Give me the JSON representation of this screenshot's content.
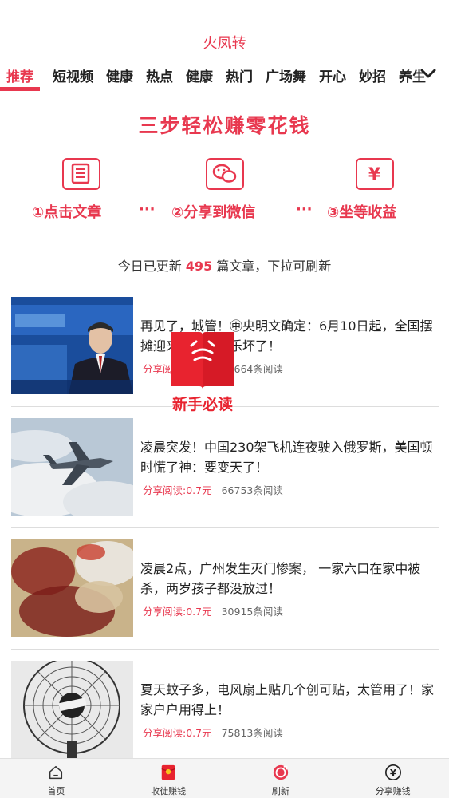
{
  "header": {
    "title": "火凤转"
  },
  "tabs": [
    {
      "label": "推荐",
      "active": true
    },
    {
      "label": "短视频"
    },
    {
      "label": "健康"
    },
    {
      "label": "热点"
    },
    {
      "label": "健康"
    },
    {
      "label": "热门"
    },
    {
      "label": "广场舞"
    },
    {
      "label": "开心"
    },
    {
      "label": "妙招"
    },
    {
      "label": "养生"
    }
  ],
  "banner": {
    "title": "三步轻松赚零花钱",
    "steps": [
      {
        "label": "①点击文章",
        "icon": "article-icon"
      },
      {
        "label": "②分享到微信",
        "icon": "wechat-icon"
      },
      {
        "label": "③坐等收益",
        "icon": "yen-icon"
      }
    ],
    "dots": "···"
  },
  "update": {
    "prefix": "今日已更新",
    "count": "495",
    "suffix": "篇文章，下拉可刷新"
  },
  "articles": [
    {
      "title": "再见了，城管！㊥央明文确定：6月10日起，全国摆摊迎来多数摊贩乐坏了！",
      "share": "分享阅读:0.7元",
      "reads": "24664条阅读"
    },
    {
      "title": "凌晨突发！中国230架飞机连夜驶入俄罗斯，美国顿时慌了神：要变天了！",
      "share": "分享阅读:0.7元",
      "reads": "66753条阅读"
    },
    {
      "title": "凌晨2点，广州发生灭门惨案， 一家六口在家中被杀，两岁孩子都没放过！",
      "share": "分享阅读:0.7元",
      "reads": "30915条阅读"
    },
    {
      "title": "夏天蚊子多，电风扇上贴几个创可贴，太管用了！家家户户用得上！",
      "share": "分享阅读:0.7元",
      "reads": "75813条阅读"
    }
  ],
  "floating_guide": {
    "label": "新手必读"
  },
  "bottom_nav": [
    {
      "label": "首页",
      "icon": "home-icon"
    },
    {
      "label": "收徒赚钱",
      "icon": "red-envelope-icon"
    },
    {
      "label": "刷新",
      "icon": "refresh-icon"
    },
    {
      "label": "分享赚钱",
      "icon": "yen-coin-icon"
    }
  ],
  "colors": {
    "accent": "#e8384f",
    "nav_bg": "#f4f4f4"
  }
}
